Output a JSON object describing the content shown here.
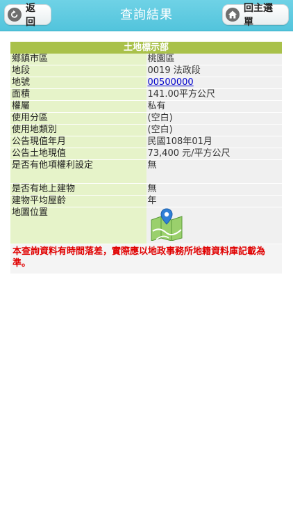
{
  "header": {
    "title": "查詢結果",
    "back_label": "返回",
    "home_label": "回主選單"
  },
  "section": {
    "title": "土地標示部"
  },
  "rows": [
    {
      "label": "鄉鎮市區",
      "value": "桃園區"
    },
    {
      "label": "地段",
      "value": "0019 法政段"
    },
    {
      "label": "地號",
      "value": "00500000"
    },
    {
      "label": "面積",
      "value": "141.00平方公尺"
    },
    {
      "label": "權屬",
      "value": "私有"
    },
    {
      "label": "使用分區",
      "value": "(空白)"
    },
    {
      "label": "使用地類別",
      "value": "(空白)"
    },
    {
      "label": "公告現值年月",
      "value": "民國108年01月"
    },
    {
      "label": "公告土地現值",
      "value": "73,400 元/平方公尺"
    },
    {
      "label": "是否有他項權利設定",
      "value": "無"
    },
    {
      "label": "是否有地上建物",
      "value": "無"
    },
    {
      "label": "建物平均屋齡",
      "value": "年"
    },
    {
      "label": "地圖位置",
      "icon": "map-pin-icon"
    }
  ],
  "notice": "本查詢資料有時間落差，實際應以地政事務所地籍資料庫記載為準。",
  "colors": {
    "header": "#5ccbe0",
    "section_header": "#a9c14a",
    "label_cell": "#e6f3c9",
    "value_cell": "#f0f0f0",
    "notice_text": "#e00000",
    "link": "#0000cc"
  }
}
